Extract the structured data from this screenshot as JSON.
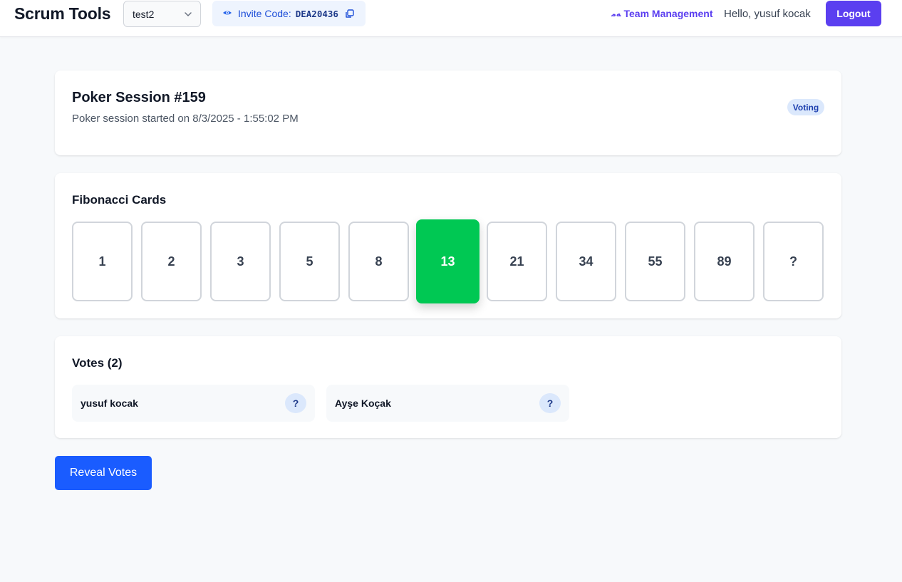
{
  "header": {
    "brand": "Scrum Tools",
    "team_select": {
      "value": "test2",
      "icon": "chevron-down-icon"
    },
    "invite": {
      "label": "Invite Code:",
      "code": "DEA20436",
      "icon": "eye-icon",
      "copy_icon": "copy-icon"
    },
    "team_management": {
      "label": "Team Management",
      "icon": "team-icon",
      "icon_glyph": "ﻪﻣ"
    },
    "greeting": "Hello, yusuf kocak",
    "logout_label": "Logout"
  },
  "session": {
    "title": "Poker Session #159",
    "subtitle": "Poker session started on 8/3/2025 - 1:55:02 PM",
    "status": "Voting"
  },
  "cards": {
    "title": "Fibonacci Cards",
    "values": [
      "1",
      "2",
      "3",
      "5",
      "8",
      "13",
      "21",
      "34",
      "55",
      "89",
      "?"
    ],
    "selected": "13"
  },
  "votes": {
    "title": "Votes (2)",
    "items": [
      {
        "name": "yusuf kocak",
        "vote": "?"
      },
      {
        "name": "Ayşe Koçak",
        "vote": "?"
      }
    ]
  },
  "reveal_label": "Reveal Votes",
  "colors": {
    "accent": "#5b3ff0",
    "selected_card": "#00c853",
    "reveal_button": "#1a5cff",
    "badge_bg": "#dbe8fc"
  }
}
